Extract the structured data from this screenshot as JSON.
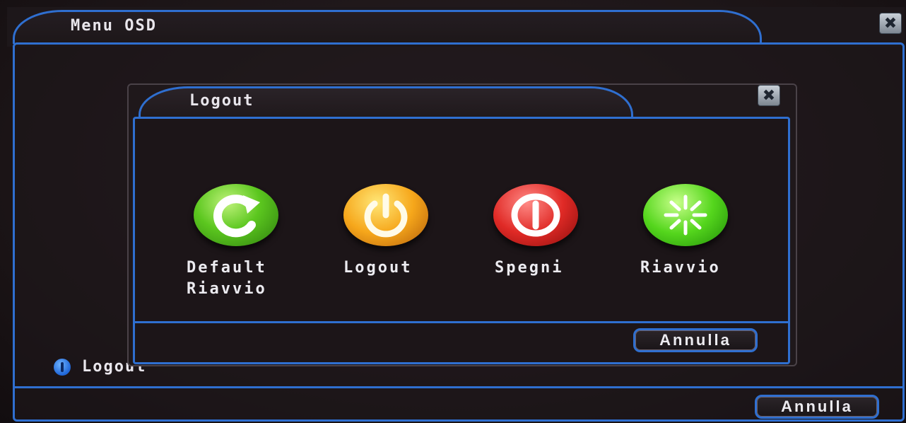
{
  "outer_window": {
    "title": "Menu OSD",
    "close_glyph": "✖",
    "status_icon": "info-icon",
    "status_text": "Logout",
    "cancel_label": "Annulla"
  },
  "dialog": {
    "title": "Logout",
    "close_glyph": "✖",
    "cancel_label": "Annulla",
    "options": [
      {
        "label": "Default\nRiavvio",
        "icon": "refresh-icon",
        "color": "#5cc71f"
      },
      {
        "label": "Logout",
        "icon": "power-icon",
        "color": "#f6a71b"
      },
      {
        "label": "Spegni",
        "icon": "shutdown-icon",
        "color": "#e02a26"
      },
      {
        "label": "Riavvio",
        "icon": "restart-icon",
        "color": "#55d61d"
      }
    ]
  },
  "colors": {
    "frame_blue": "#2f6fd0",
    "background": "#1b1416",
    "text": "#e9e6ec"
  }
}
